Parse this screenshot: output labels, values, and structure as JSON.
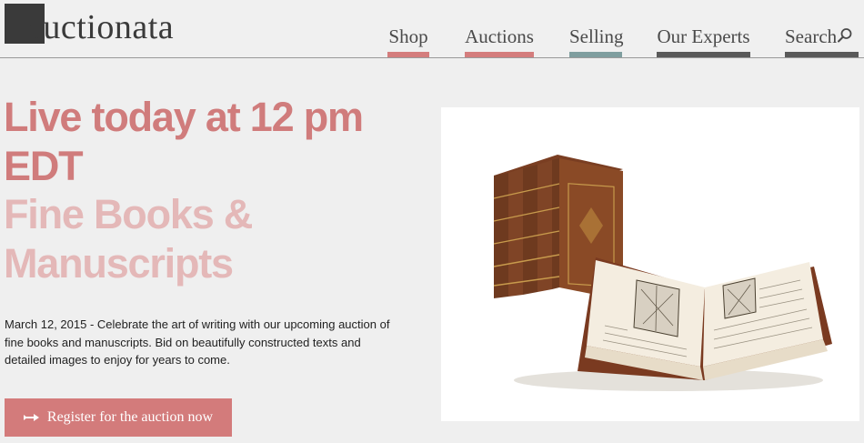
{
  "header": {
    "logo_text": "auctionata",
    "nav": [
      {
        "label": "Shop",
        "color": "#d47d7d"
      },
      {
        "label": "Auctions",
        "color": "#d47d7d"
      },
      {
        "label": "Selling",
        "color": "#7f9e9f"
      },
      {
        "label": "Our Experts",
        "color": "#5a5a5a"
      },
      {
        "label": "Search",
        "color": "#5a5a5a",
        "icon": "search-icon"
      }
    ]
  },
  "hero": {
    "title_live": "Live today at 12 pm EDT",
    "title_sale": "Fine Books & Manuscripts",
    "description": "March 12, 2015 - Celebrate the art of writing with our upcoming auction of fine books and manuscripts. Bid on beautifully constructed texts and detailed images to enjoy for years to come.",
    "cta_label": "Register for the auction now",
    "cta_icon": "gavel-arrow-icon",
    "image_subject": "books-image"
  },
  "colors": {
    "accent": "#d37b7b",
    "accent_light": "#e4b8b8",
    "background": "#efefef"
  }
}
